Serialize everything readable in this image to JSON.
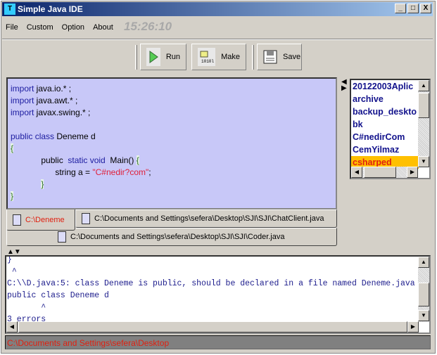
{
  "window": {
    "title": "Simple Java IDE",
    "controls": [
      "_",
      "□",
      "X"
    ]
  },
  "menu": {
    "items": [
      "File",
      "Custom",
      "Option",
      "About"
    ],
    "clock": "15:26:10"
  },
  "toolbar": {
    "run_label": "Run",
    "make_label": "Make",
    "save_label": "Save"
  },
  "editor": {
    "lines": [
      [
        {
          "t": "import",
          "c": "kw"
        },
        {
          "t": " java.io.* ;"
        }
      ],
      [
        {
          "t": "import",
          "c": "kw"
        },
        {
          "t": " java.awt.* ;"
        }
      ],
      [
        {
          "t": "import",
          "c": "kw"
        },
        {
          "t": " javax.swing.* ;"
        }
      ],
      [],
      [
        {
          "t": "public class",
          "c": "kw"
        },
        {
          "t": " Deneme d"
        }
      ],
      [
        {
          "t": "{",
          "c": "br"
        }
      ],
      [
        {
          "t": "             public  "
        },
        {
          "t": "static void",
          "c": "kw"
        },
        {
          "t": "  Main() "
        },
        {
          "t": "{",
          "c": "br"
        }
      ],
      [
        {
          "t": "                   string a = "
        },
        {
          "t": "\"C#nedir?com\"",
          "c": "str"
        },
        {
          "t": ";"
        }
      ],
      [
        {
          "t": "             "
        },
        {
          "t": "}",
          "c": "br"
        }
      ],
      [
        {
          "t": "}",
          "c": "br"
        }
      ]
    ]
  },
  "tabs": [
    {
      "label": "C:\\Deneme",
      "active": true
    },
    {
      "label": "C:\\Documents and Settings\\sefera\\Desktop\\SJI\\SJI\\ChatClient.java"
    },
    {
      "label": "C:\\Documents and Settings\\sefera\\Desktop\\SJI\\SJI\\Coder.java"
    }
  ],
  "file_list": {
    "items": [
      "20122003Aplic",
      "archive",
      "backup_deskto",
      "bk",
      "C#nedirCom",
      "CemYilmaz",
      "csharped"
    ],
    "selected": "csharped"
  },
  "console": {
    "lines": [
      "}",
      " ^",
      "C:\\\\D.java:5: class Deneme is public, should be declared in a file named Deneme.java",
      "public class Deneme d",
      "       ^",
      "3 errors"
    ]
  },
  "status": {
    "path": "C:\\Documents and Settings\\sefera\\Desktop"
  },
  "colors": {
    "editor_bg": "#c8c8f8",
    "keyword": "#1c1ca0",
    "string": "#e0203a",
    "selected_bg": "#ffc000",
    "status_text": "#e02010"
  }
}
